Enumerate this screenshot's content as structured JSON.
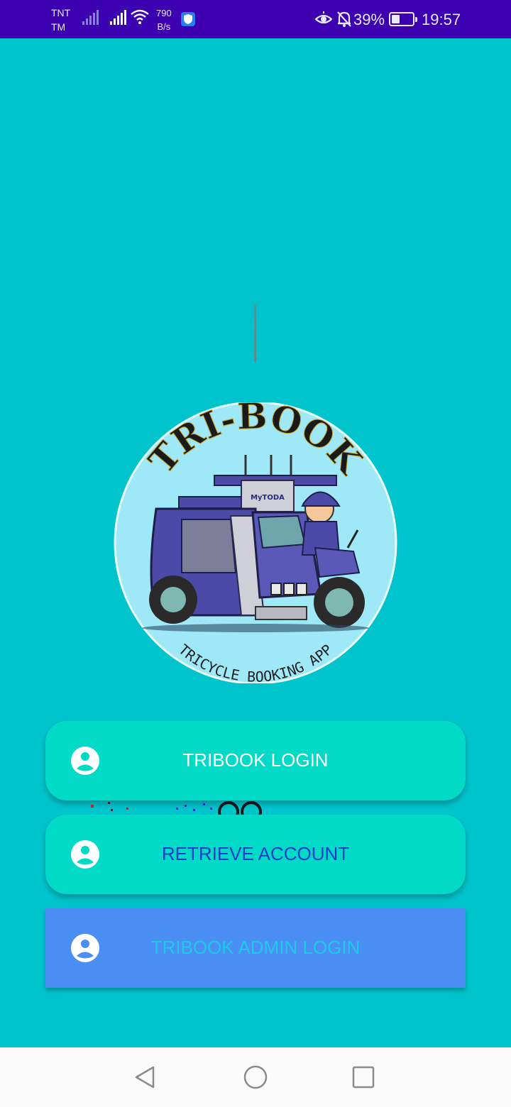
{
  "status_bar": {
    "carrier_line1": "TNT",
    "carrier_line2": "TM",
    "net_speed_value": "790",
    "net_speed_unit": "B/s",
    "battery_percent": "39%",
    "battery_level": 0.39,
    "time": "19:57",
    "icons": [
      "signal-icon",
      "signal-icon",
      "wifi-icon",
      "shield-icon",
      "eye-icon",
      "bell-off-icon",
      "battery-icon"
    ]
  },
  "logo": {
    "title": "TRI-BOOK",
    "subtitle": "TRICYCLE BOOKING APP",
    "plate_text": "MyTODA"
  },
  "buttons": {
    "login_label": "TRIBOOK LOGIN",
    "retrieve_label": "RETRIEVE ACCOUNT",
    "admin_label": "TRIBOOK ADMIN LOGIN",
    "icon": "account-circle-icon"
  },
  "nav_bar": {
    "icons": [
      "back-icon",
      "home-icon",
      "recents-icon"
    ]
  },
  "colors": {
    "background": "#00c4cc",
    "status_bar": "#3c00b0",
    "button_teal": "#00dac6",
    "button_blue": "#4b8ff5",
    "retrieve_text": "#1a3fc8",
    "admin_text": "#1ec9e6"
  }
}
